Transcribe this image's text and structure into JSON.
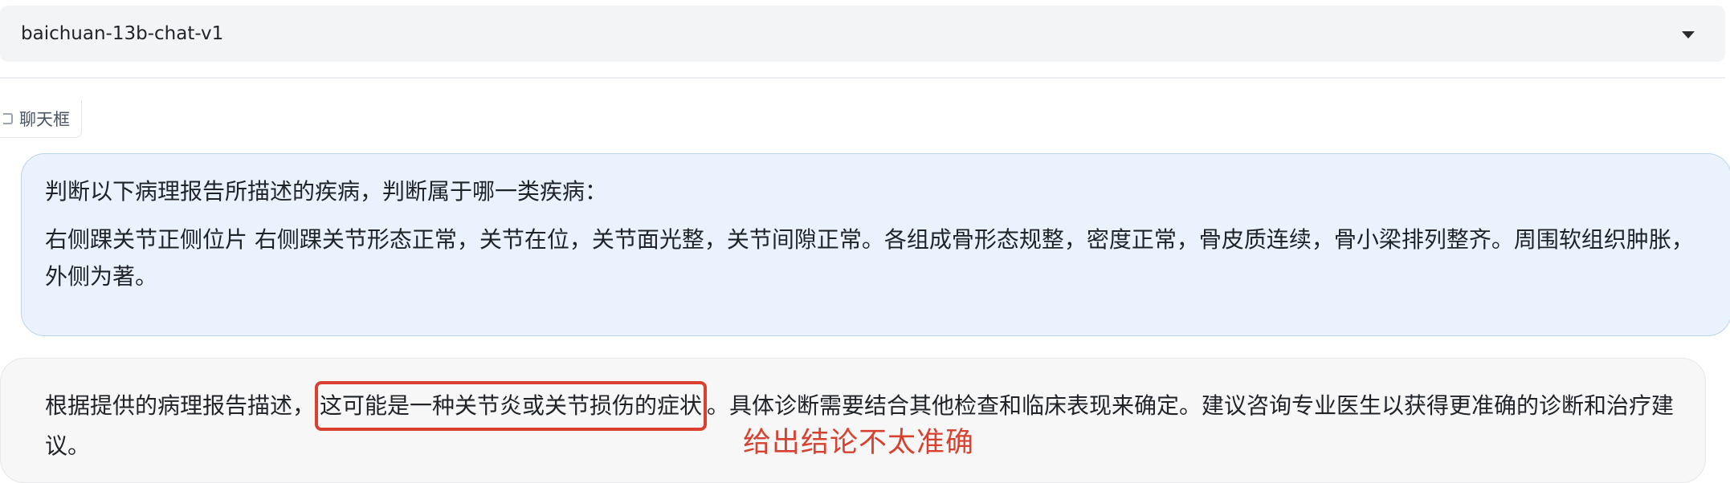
{
  "model_select": {
    "value": "baichuan-13b-chat-v1",
    "icon": "chevron-down-icon"
  },
  "chat": {
    "label": "聊天框",
    "label_icon": "chat-icon",
    "user_message": {
      "question": "判断以下病理报告所描述的疾病，判断属于哪一类疾病：",
      "report": "右侧踝关节正侧位片 右侧踝关节形态正常，关节在位，关节面光整，关节间隙正常。各组成骨形态规整，密度正常，骨皮质连续，骨小梁排列整齐。周围软组织肿胀，外侧为著。"
    },
    "bot_message": {
      "before": "根据提供的病理报告描述，",
      "highlight": "这可能是一种关节炎或关节损伤的症状",
      "after": "。具体诊断需要结合其他检查和临床表现来确定。建议咨询专业医生以获得更准确的诊断和治疗建议。"
    }
  },
  "annotation": {
    "text": "给出结论不太准确",
    "color": "#d8412f"
  }
}
